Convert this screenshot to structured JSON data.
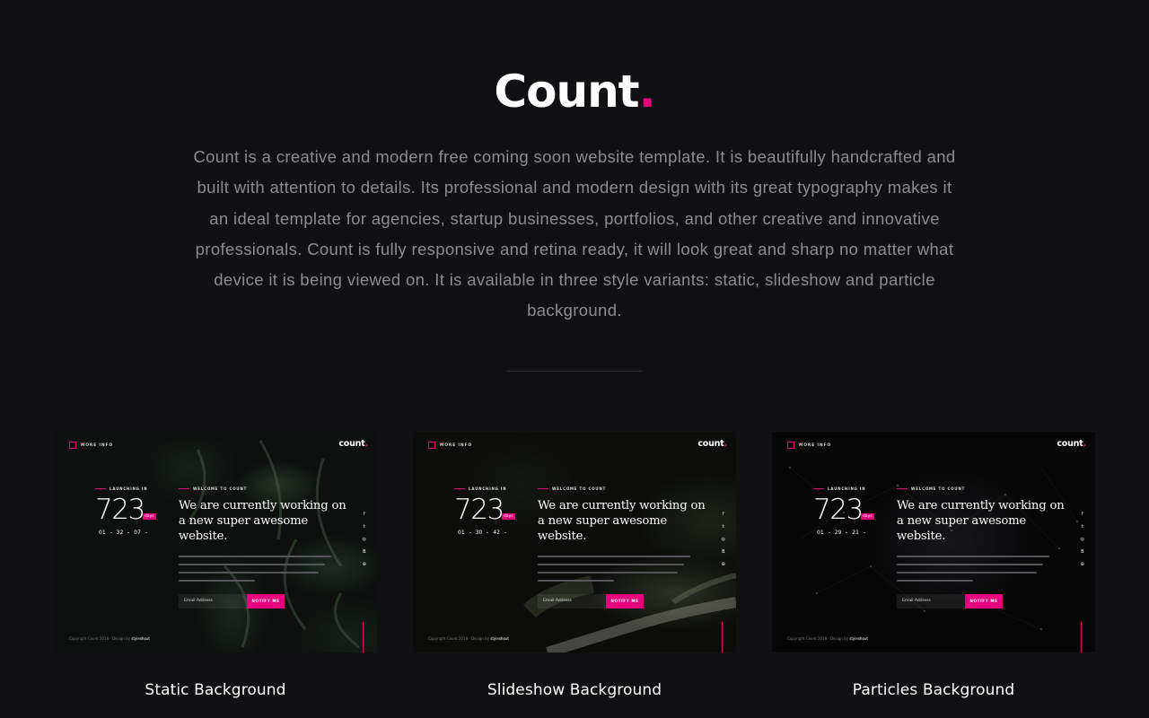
{
  "header": {
    "logo_text": "Count",
    "logo_dot": ".",
    "intro": "Count is a creative and modern free coming soon website template. It is beautifully handcrafted and built with attention to details. Its professional and modern design with its great typography makes it an ideal template for agencies, startup businesses, portfolios, and other creative and innovative professionals. Count is fully responsive and retina ready, it will look great and sharp no matter what device it is being viewed on. It is available in three style variants: static, slideshow and particle background."
  },
  "colors": {
    "background": "#111113",
    "accent": "#e6007e",
    "intro_text": "#8c8c8f"
  },
  "cards": [
    {
      "title": "Static Background",
      "preview": {
        "menu": "MORE INFO",
        "logo": "count",
        "logo_dot": ".",
        "launch_label": "LAUNCHING IN",
        "count": "723",
        "count_unit": "days",
        "time": [
          "01",
          "32",
          "07"
        ],
        "welcome_label": "WELCOME TO COUNT",
        "headline": "We are currently working on a new super awesome website.",
        "input_placeholder": "Email Address",
        "button": "NOTIFY ME",
        "footer": "Copyright Count 2018 · Design by",
        "footer_credit": "styleshout"
      }
    },
    {
      "title": "Slideshow Background",
      "preview": {
        "menu": "MORE INFO",
        "logo": "count",
        "logo_dot": ".",
        "launch_label": "LAUNCHING IN",
        "count": "723",
        "count_unit": "days",
        "time": [
          "01",
          "30",
          "42"
        ],
        "welcome_label": "WELCOME TO COUNT",
        "headline": "We are currently working on a new super awesome website.",
        "input_placeholder": "Email Address",
        "button": "NOTIFY ME",
        "footer": "Copyright Count 2018 · Design by",
        "footer_credit": "styleshout"
      }
    },
    {
      "title": "Particles Background",
      "preview": {
        "menu": "MORE INFO",
        "logo": "count",
        "logo_dot": ".",
        "launch_label": "LAUNCHING IN",
        "count": "723",
        "count_unit": "days",
        "time": [
          "01",
          "29",
          "21"
        ],
        "welcome_label": "WELCOME TO COUNT",
        "headline": "We are currently working on a new super awesome website.",
        "input_placeholder": "Email Address",
        "button": "NOTIFY ME",
        "footer": "Copyright Count 2018 · Design by",
        "footer_credit": "styleshout"
      }
    }
  ],
  "social_icons": [
    "facebook-icon",
    "twitter-icon",
    "instagram-icon",
    "behance-icon",
    "dribbble-icon"
  ]
}
